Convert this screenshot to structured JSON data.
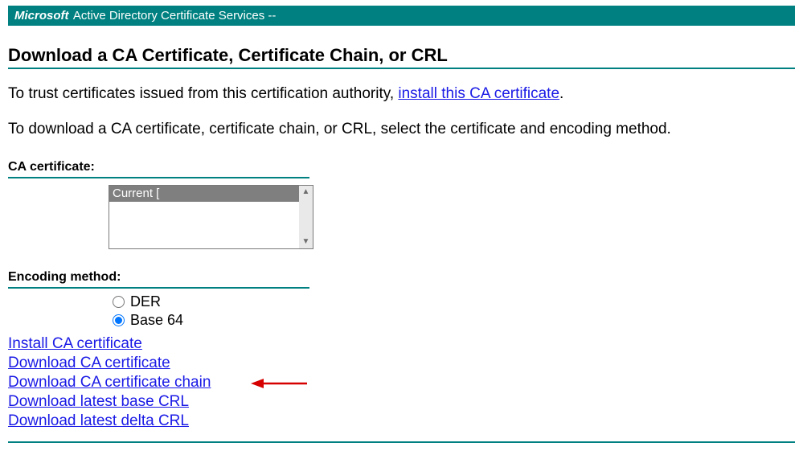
{
  "header": {
    "brand": "Microsoft",
    "service": " Active Directory Certificate Services  --"
  },
  "page": {
    "title": "Download a CA Certificate, Certificate Chain, or CRL",
    "trust_text_prefix": "To trust certificates issued from this certification authority, ",
    "trust_link": "install this CA certificate",
    "trust_text_suffix": ".",
    "download_instruction": "To download a CA certificate, certificate chain, or CRL, select the certificate and encoding method."
  },
  "ca_section": {
    "label": "CA certificate:",
    "selected_item_left": "Current [",
    "selected_item_right": "]"
  },
  "encoding_section": {
    "label": "Encoding method:",
    "options": [
      {
        "label": "DER",
        "checked": false
      },
      {
        "label": "Base 64",
        "checked": true
      }
    ]
  },
  "links": {
    "install_ca": "Install CA certificate",
    "download_ca": "Download CA certificate",
    "download_chain": "Download CA certificate chain",
    "download_base_crl": "Download latest base CRL",
    "download_delta_crl": "Download latest delta CRL"
  }
}
